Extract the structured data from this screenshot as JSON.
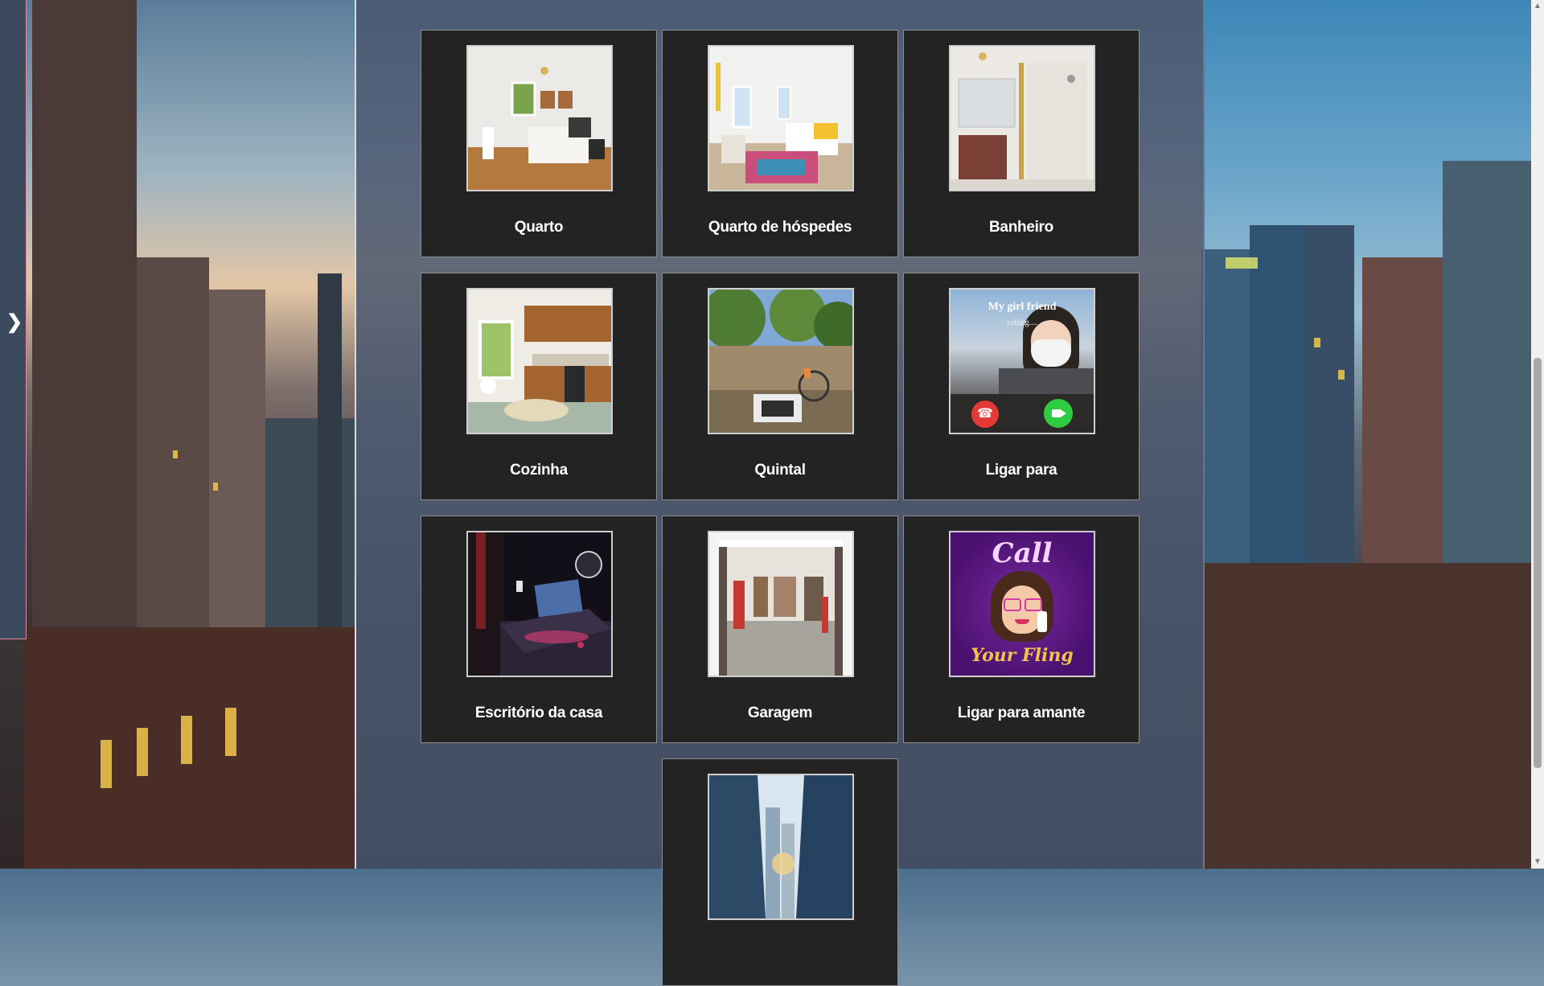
{
  "drawer": {
    "toggle_icon": "chevron-right-icon",
    "toggle_glyph": "❯"
  },
  "rooms": [
    {
      "label": "Quarto",
      "icon": "bedroom-photo"
    },
    {
      "label": "Quarto de hóspedes",
      "icon": "guest-bedroom-photo"
    },
    {
      "label": "Banheiro",
      "icon": "bathroom-photo"
    },
    {
      "label": "Cozinha",
      "icon": "kitchen-photo"
    },
    {
      "label": "Quintal",
      "icon": "backyard-photo"
    },
    {
      "label": "Ligar para",
      "icon": "video-call-photo",
      "caller_name": "My girl friend",
      "caller_status": "calling...."
    },
    {
      "label": "Escritório da casa",
      "icon": "home-office-photo"
    },
    {
      "label": "Garagem",
      "icon": "garage-photo"
    },
    {
      "label": "Ligar para amante",
      "icon": "call-your-fling-photo",
      "art_line1": "Call",
      "art_line2": "Your Fling"
    },
    {
      "label": "",
      "icon": "city-skyscrapers-photo"
    }
  ],
  "colors": {
    "card_bg": "#232323",
    "panel_bg": "#4a5870",
    "label": "#ffffff",
    "decline": "#e53935",
    "accept": "#2ecc40"
  }
}
